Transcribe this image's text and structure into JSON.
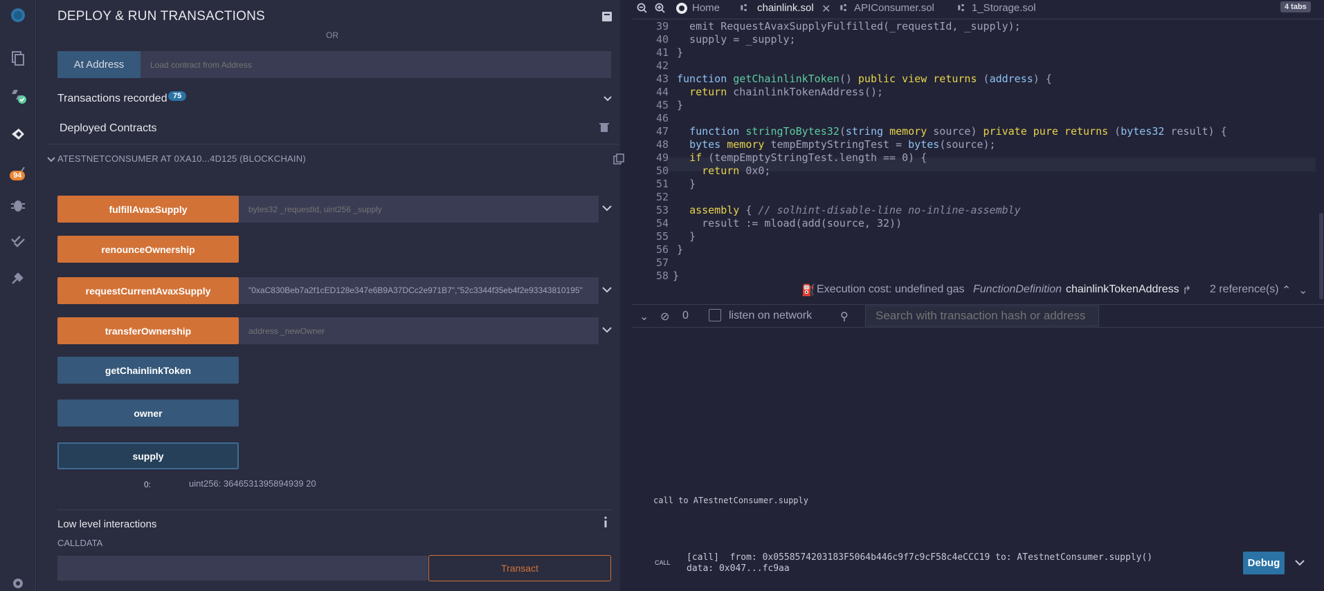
{
  "panel": {
    "title": "DEPLOY & RUN TRANSACTIONS",
    "or_label": "OR",
    "at_address_button": "At Address",
    "at_address_placeholder": "Load contract from Address",
    "transactions_recorded": "Transactions recorded",
    "transactions_count": "75",
    "deployed_contracts": "Deployed Contracts",
    "contract_title": "ATESTNETCONSUMER AT 0XA10...4D125 (BLOCKCHAIN)",
    "functions": [
      {
        "label": "fulfillAvaxSupply",
        "input": "bytes32 _requestId, uint256 _supply"
      },
      {
        "label": "renounceOwnership"
      },
      {
        "label": "requestCurrentAvaxSupply",
        "input": "\"0xaC830Beb7a2f1cED128e347e6B9A37DCc2e971B7\",\"52c3344f35eb4f2e93343810195\""
      },
      {
        "label": "transferOwnership",
        "input": "address _newOwner"
      },
      {
        "label": "getChainlinkToken"
      },
      {
        "label": "owner"
      },
      {
        "label": "supply"
      }
    ],
    "result_index": "0:",
    "result_value": "uint256: 3646531395894939 20",
    "low_level_title": "Low level interactions",
    "calldata_label": "CALLDATA",
    "transact_button": "Transact"
  },
  "rail": {
    "badge": "94"
  },
  "tabs": {
    "home": "Home",
    "items": [
      "chainlink.sol",
      "APIConsumer.sol",
      "1_Storage.sol"
    ],
    "count": "4 tabs"
  },
  "editor": {
    "line_numbers": [
      "39",
      "40",
      "41",
      "42",
      "43",
      "44",
      "45",
      "46",
      "47",
      "48",
      "49",
      "50",
      "51",
      "52",
      "53",
      "54",
      "55",
      "56",
      "57",
      "58"
    ]
  },
  "status": {
    "execution_cost": "Execution cost: undefined gas",
    "function_def": "FunctionDefinition",
    "function_name": "chainlinkTokenAddress",
    "references": "2 reference(s)"
  },
  "terminal": {
    "count": "0",
    "listen_label": "listen on network",
    "search_placeholder": "Search with transaction hash or address",
    "call_line": "call to ATestnetConsumer.supply",
    "call_tag": "CALL",
    "tx_line_1": "[call]  from: 0x0558574203183F5064b446c9f7c9cF58c4eCCC19 to: ATestnetConsumer.supply()",
    "tx_line_2": "data: 0x047...fc9aa",
    "debug_button": "Debug"
  }
}
